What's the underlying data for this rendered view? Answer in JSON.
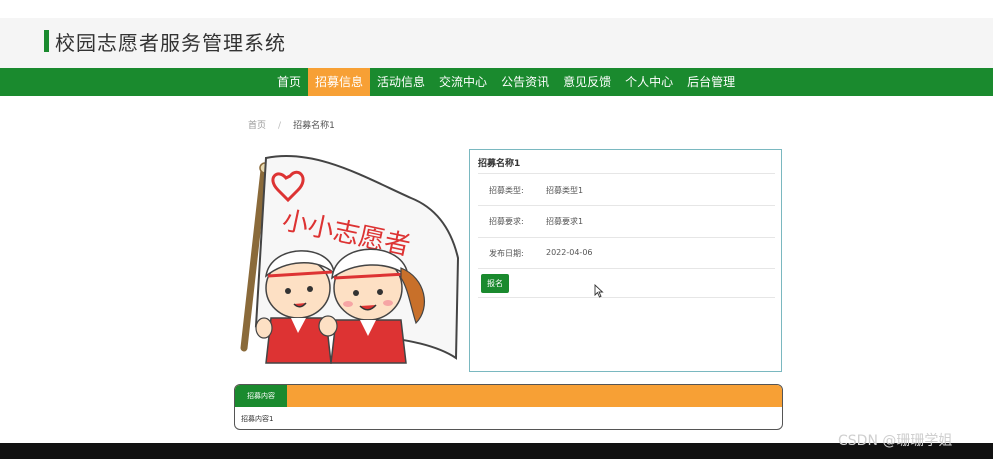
{
  "header": {
    "title": "校园志愿者服务管理系统"
  },
  "nav": {
    "items": [
      {
        "label": "首页"
      },
      {
        "label": "招募信息",
        "active": true
      },
      {
        "label": "活动信息"
      },
      {
        "label": "交流中心"
      },
      {
        "label": "公告资讯"
      },
      {
        "label": "意见反馈"
      },
      {
        "label": "个人中心"
      },
      {
        "label": "后台管理"
      }
    ]
  },
  "breadcrumb": {
    "home": "首页",
    "separator": "/",
    "current": "招募名称1"
  },
  "detail": {
    "title": "招募名称1",
    "type_label": "招募类型:",
    "type_value": "招募类型1",
    "requirement_label": "招募要求:",
    "requirement_value": "招募要求1",
    "date_label": "发布日期:",
    "date_value": "2022-04-06",
    "signup_label": "报名"
  },
  "hero": {
    "flag_text": "小小志愿者"
  },
  "content": {
    "tab_label": "招募内容",
    "text": "招募内容1"
  },
  "watermark": "CSDN @珊珊学姐",
  "colors": {
    "primary": "#1a8a2e",
    "accent": "#f7a035"
  }
}
